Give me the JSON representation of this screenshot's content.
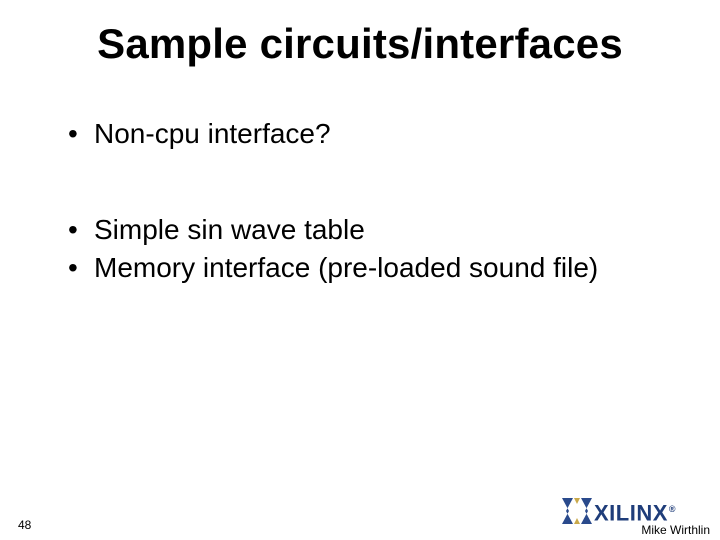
{
  "slide": {
    "title": "Sample circuits/interfaces",
    "bullets_group1": [
      "Non-cpu interface?"
    ],
    "bullets_group2": [
      "Simple sin wave table",
      "Memory interface (pre-loaded sound file)"
    ]
  },
  "footer": {
    "page_number": "48",
    "author": "Mike Wirthlin",
    "logo_text": "XILINX",
    "logo_reg": "®"
  }
}
